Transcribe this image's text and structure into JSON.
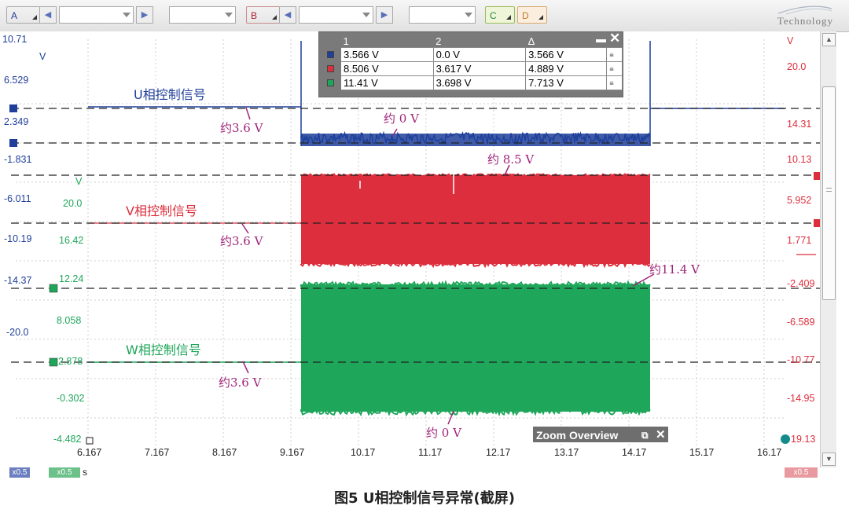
{
  "toolbar": {
    "channel_a": "A",
    "channel_b": "B",
    "channel_c": "C",
    "channel_d": "D",
    "logo_text": "Technology"
  },
  "colors": {
    "u": "#1f3f9a",
    "v": "#dc2e3c",
    "w": "#1ea65a",
    "annot": "#a0247a"
  },
  "left_axis_outer": {
    "unit": "V",
    "ticks": [
      "10.71",
      "6.529",
      "2.349",
      "-1.831",
      "-6.011",
      "-10.19",
      "-14.37",
      "-20.0"
    ]
  },
  "left_axis_inner": {
    "unit": "V",
    "ticks": [
      "20.0",
      "16.42",
      "12.24",
      "8.058",
      "2.878",
      "-0.302",
      "-4.482"
    ]
  },
  "right_axis": {
    "unit": "V",
    "ticks": [
      "20.0",
      "14.31",
      "10.13",
      "5.952",
      "1.771",
      "-2.409",
      "-6.589",
      "-10.77",
      "-14.95",
      "19.13"
    ]
  },
  "x_axis": {
    "unit": "s",
    "ticks": [
      "6.167",
      "7.167",
      "8.167",
      "9.167",
      "10.17",
      "11.17",
      "12.17",
      "13.17",
      "14.17",
      "15.17",
      "16.17"
    ]
  },
  "labels": {
    "u_signal": "U相控制信号",
    "v_signal": "V相控制信号",
    "w_signal": "W相控制信号"
  },
  "annotations": {
    "u_low": "约3.6 V",
    "u_zero": "约 0 V",
    "v_low": "约3.6 V",
    "v_high": "约 8.5 V",
    "w_low": "约3.6 V",
    "w_high": "约11.4 V",
    "w_zero": "约 0 V"
  },
  "measurements": {
    "headers": [
      "1",
      "2",
      "Δ"
    ],
    "rows": [
      {
        "c1": "3.566 V",
        "c2": "0.0 V",
        "delta": "3.566 V"
      },
      {
        "c1": "8.506 V",
        "c2": "3.617 V",
        "delta": "4.889 V"
      },
      {
        "c1": "11.41 V",
        "c2": "3.698 V",
        "delta": "7.713 V"
      }
    ]
  },
  "zoom_overview": {
    "title": "Zoom Overview"
  },
  "footer": {
    "zoom_tag_1": "x0.5",
    "zoom_tag_2": "x0.5",
    "zoom_tag_right": "x0.5",
    "time_unit": "s"
  },
  "caption": "图5 U相控制信号异常(截屏)"
}
